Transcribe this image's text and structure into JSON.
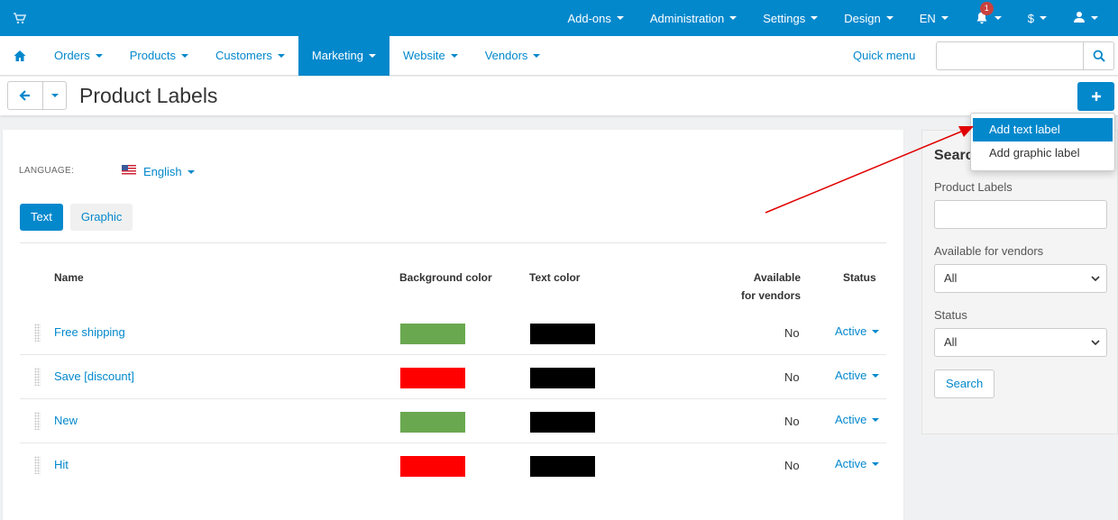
{
  "topbar": {
    "cart_icon": "cart-icon",
    "items": [
      {
        "label": "Add-ons"
      },
      {
        "label": "Administration"
      },
      {
        "label": "Settings"
      },
      {
        "label": "Design"
      },
      {
        "label": "EN"
      }
    ],
    "notifications_count": "1",
    "currency": "$",
    "user_icon": "user-icon"
  },
  "nav": {
    "home_icon": "home-icon",
    "items": [
      {
        "label": "Orders"
      },
      {
        "label": "Products"
      },
      {
        "label": "Customers"
      },
      {
        "label": "Marketing",
        "active": true
      },
      {
        "label": "Website"
      },
      {
        "label": "Vendors"
      }
    ],
    "quick_menu": "Quick menu",
    "search_value": ""
  },
  "page": {
    "title": "Product Labels"
  },
  "main": {
    "language_label": "LANGUAGE:",
    "language_value": "English",
    "tabs": [
      {
        "label": "Text",
        "active": true
      },
      {
        "label": "Graphic",
        "active": false
      }
    ],
    "columns": {
      "name": "Name",
      "bg": "Background color",
      "text": "Text color",
      "vendors_1": "Available",
      "vendors_2": "for vendors",
      "status": "Status"
    },
    "rows": [
      {
        "name": "Free shipping",
        "bg": "#6aa84f",
        "text_color": "#000000",
        "vendors": "No",
        "status": "Active"
      },
      {
        "name": "Save [discount]",
        "bg": "#ff0000",
        "text_color": "#000000",
        "vendors": "No",
        "status": "Active"
      },
      {
        "name": "New",
        "bg": "#6aa84f",
        "text_color": "#000000",
        "vendors": "No",
        "status": "Active"
      },
      {
        "name": "Hit",
        "bg": "#ff0000",
        "text_color": "#000000",
        "vendors": "No",
        "status": "Active"
      }
    ]
  },
  "sidebar": {
    "title": "Search",
    "product_labels_label": "Product Labels",
    "product_labels_value": "",
    "vendors_label": "Available for vendors",
    "vendors_value": "All",
    "status_label": "Status",
    "status_value": "All",
    "search_button": "Search"
  },
  "dropdown": {
    "items": [
      {
        "label": "Add text label",
        "highlighted": true
      },
      {
        "label": "Add graphic label",
        "highlighted": false
      }
    ]
  },
  "colors": {
    "accent": "#0388cc",
    "annotation_arrow": "#e00000",
    "badge": "#c8423e"
  }
}
